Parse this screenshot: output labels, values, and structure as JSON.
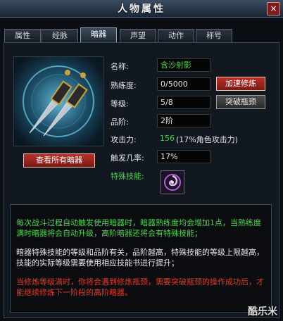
{
  "window": {
    "title": "人物属性",
    "close_label": "×"
  },
  "tabs": [
    "属性",
    "经脉",
    "暗器",
    "声望",
    "动作",
    "称号"
  ],
  "active_tab": "暗器",
  "weapon": {
    "name_label": "名称:",
    "name_value": "含沙射影",
    "proficiency_label": "熟练度:",
    "proficiency_value": "0/5000",
    "level_label": "等级:",
    "level_value": "5/8",
    "grade_label": "品阶:",
    "grade_value": "2阶",
    "attack_label": "攻击力:",
    "attack_value": "156",
    "attack_note": "(17%角色攻击力)",
    "trigger_label": "触发几率:",
    "trigger_value": "17%",
    "skill_label": "特殊技能:"
  },
  "buttons": {
    "view_all": "查看所有暗器",
    "speed_train": "加速修炼",
    "breakthrough": "突破瓶颈"
  },
  "info": {
    "p1": "每次战斗过程自动触发使用暗器时，暗器熟练度均会增加1点，当熟练度满时暗器将会自动升级，高阶暗器还将会有特殊技能；",
    "p2": "暗器特殊技能的等级和品阶有关，品阶越高，特殊技能的等级上限越高，技能的实际等级需要使用相应技能书进行提升；",
    "p3": "当修炼等级满时，你将会遇到修炼瓶颈，需要突破瓶颈的操作成功后，才能继续修炼下一阶段的高阶暗器。"
  },
  "watermark": "酷乐米",
  "colors": {
    "green_text": "#47d147",
    "info_green": "#4cd64c",
    "info_red": "#e23a2a",
    "button_red": "#9a2620",
    "window_bg": "#0b0f14"
  }
}
